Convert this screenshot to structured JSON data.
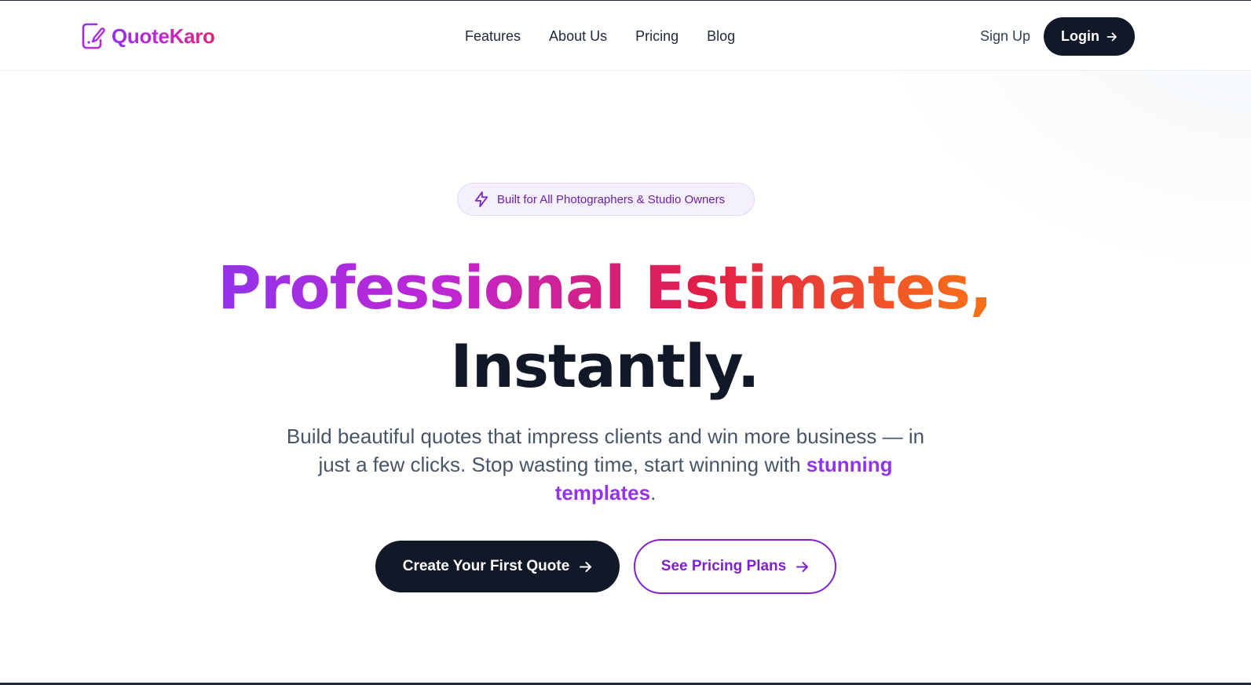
{
  "brand": {
    "name": "QuoteKaro",
    "logo_icon": "file-pen-icon"
  },
  "nav": {
    "links": [
      "Features",
      "About Us",
      "Pricing",
      "Blog"
    ],
    "signup_label": "Sign Up",
    "login_label": "Login"
  },
  "hero": {
    "badge_icon": "lightning-icon",
    "badge_text": "Built for All Photographers & Studio Owners",
    "headline_gradient": "Professional Estimates,",
    "headline_plain": "Instantly.",
    "subtitle_before": "Build beautiful quotes that impress clients and win more business — in just a few clicks. Stop wasting time, start winning with ",
    "subtitle_highlight": "stunning templates",
    "subtitle_after": ".",
    "cta_primary": "Create Your First Quote",
    "cta_secondary": "See Pricing Plans"
  },
  "colors": {
    "accent_purple": "#9333ea",
    "accent_pink": "#e11d48",
    "accent_orange": "#f97316",
    "dark": "#111827"
  }
}
